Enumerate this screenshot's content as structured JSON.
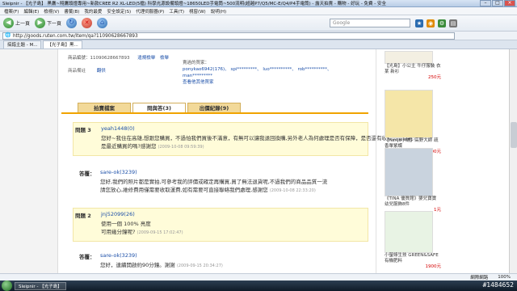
{
  "window": {
    "title": "Sleipnir - 【光子島】 黑鷹~翔鷹頭燈專用~新款CREE R2 XL-LED(5檔) 科學光源設備頭燈~18650LED手電筒~500流明(超越P7/Q5/MC-E/Q4/P4手電筒) - 露天拍賣 - 購物 - 好玩 - 免費 - 安全"
  },
  "menu": [
    "檔案(F)",
    "編輯(E)",
    "檢視(V)",
    "書籤(B)",
    "我的最愛",
    "安全設定(S)",
    "代理伺服器(P)",
    "工具(T)",
    "視窗(W)",
    "說明(H)"
  ],
  "toolbar": {
    "back": "上一頁",
    "forward": "下一頁",
    "search_placeholder": "Google"
  },
  "address": {
    "url": "http://goods.ruten.com.tw/item/qa?11090628667893"
  },
  "tabs": [
    "搞錯主題 - M...",
    "【光子島】黑..."
  ],
  "item_info": {
    "label_no": "商品編號：11090628667893",
    "report": "違規檢舉",
    "check": "檢舉",
    "label_note": "商品備註",
    "note_link": "翻供",
    "watchers_title": "賣過的買家：",
    "watchers": "ponykao6942(176)、 spi*********、 luo**********、 rob**********、 man*********",
    "more": "查看他其他買家"
  },
  "qa_tabs": [
    "拍賣檔案",
    "問與答(3)",
    "出價紀錄(9)"
  ],
  "qa": [
    {
      "q_label": "問題 3",
      "q_user": "yeah1448(0)",
      "q_lines": [
        "您好~我住在高雄,想跟您購買，不過怕我們買後不滿意，有無可以讓我退回換購,另外老人為何處理是否有保障，是否還有收費的問題呢?",
        "  是最近購買的嗎?感謝您"
      ],
      "q_time": "(2009-10-08 09:59:39)",
      "a_label": "答覆：",
      "a_user": "sare-ok(3239)",
      "a_lines": [
        "您好,我們的照片都是實拍,可參考我的評價或確定再購買,買了無法退貨呢,不過我們的商品品質一流",
        "請您放心,維修費用僅需要收取運費,如有需要可直接聯絡我們處理,感謝您"
      ],
      "a_time": "(2009-10-08 22:33:20)"
    },
    {
      "q_label": "問題 2",
      "q_user": "jnj52099(26)",
      "q_lines": [
        "使用一個 100% 亮度",
        "可用幾分鐘呢?"
      ],
      "q_time": "(2009-09-15 17:02:47)",
      "a_label": "答覆：",
      "a_user": "sare-ok(3239)",
      "a_lines": [
        "您好，連續開啟約90分鐘。謝謝"
      ],
      "a_time": "(2009-09-15 20:34:27)"
    }
  ],
  "sidebar": [
    {
      "title": "【光島】小公主 牛仔服裝 衣某 新衫",
      "price": "250元",
      "color": "#f3efe2"
    },
    {
      "title": "【nanja小舖】高野大師 疏香單紫蝶",
      "price": "1200元",
      "color": "#f5e6a8"
    },
    {
      "title": "《TINA 優質館》嬰兒寶寶 幼兒服飾8件",
      "price": "1元",
      "color": "#c9d3de"
    },
    {
      "title": "小螢綠生技 GREEN&SAFE有機肥料",
      "price": "1900元",
      "color": "#e8f3e4"
    }
  ],
  "status": {
    "zone": "網際網路",
    "zoom": "100%"
  },
  "taskbar": {
    "window": "Sleipnir - 【光子島】",
    "watermark": "#1484652"
  }
}
